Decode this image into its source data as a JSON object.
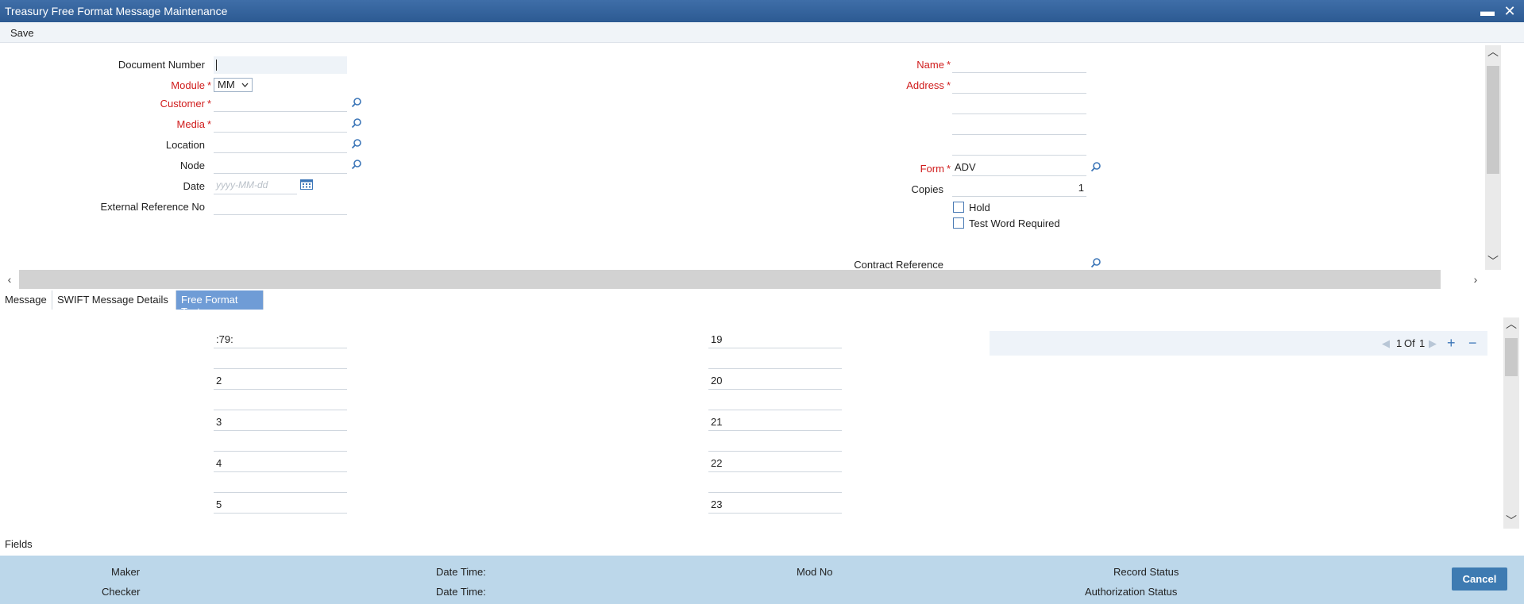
{
  "window": {
    "title": "Treasury Free Format Message Maintenance",
    "minimize": "▬",
    "close": "✕"
  },
  "toolbar": {
    "save_label": "Save"
  },
  "header": {
    "document_number": {
      "label": "Document Number",
      "value": ""
    },
    "module": {
      "label": "Module",
      "value": "MM"
    },
    "customer": {
      "label": "Customer",
      "value": ""
    },
    "media": {
      "label": "Media",
      "value": ""
    },
    "location": {
      "label": "Location",
      "value": ""
    },
    "node": {
      "label": "Node",
      "value": ""
    },
    "date": {
      "label": "Date",
      "placeholder": "yyyy-MM-dd"
    },
    "external_reference": {
      "label": "External Reference No",
      "value": ""
    },
    "name": {
      "label": "Name",
      "value": ""
    },
    "address": {
      "label": "Address",
      "lines": [
        "",
        "",
        "",
        ""
      ]
    },
    "form": {
      "label": "Form",
      "value": "ADV"
    },
    "copies": {
      "label": "Copies",
      "value": "1"
    },
    "hold": {
      "label": "Hold",
      "checked": false
    },
    "test_word": {
      "label": "Test Word Required",
      "checked": false
    },
    "contract_reference": {
      "label": "Contract Reference",
      "value": ""
    },
    "required_marker": "*"
  },
  "tabs": [
    {
      "label": "Message",
      "active": false
    },
    {
      "label": "SWIFT Message Details",
      "active": false
    },
    {
      "label": "Free Format Text",
      "active": true
    }
  ],
  "free_format": {
    "left_column": [
      ":79:",
      "",
      "2",
      "",
      "3",
      "",
      "4",
      "",
      "5"
    ],
    "right_column": [
      "19",
      "",
      "20",
      "",
      "21",
      "",
      "22",
      "",
      "23"
    ],
    "pager": {
      "current": "1",
      "of_label": "Of",
      "total": "1",
      "add": "+",
      "remove": "−"
    }
  },
  "fields_label": "Fields",
  "footer": {
    "maker": "Maker",
    "checker": "Checker",
    "date_time_1": "Date Time:",
    "date_time_2": "Date Time:",
    "mod_no": "Mod No",
    "record_status": "Record Status",
    "authorization_status": "Authorization Status",
    "cancel_label": "Cancel"
  },
  "colors": {
    "title_bar": "#2c5a92",
    "required": "#d01c1c",
    "active_tab": "#6f9cd6",
    "footer": "#bcd7ea",
    "cancel_button": "#3e7bb2"
  }
}
